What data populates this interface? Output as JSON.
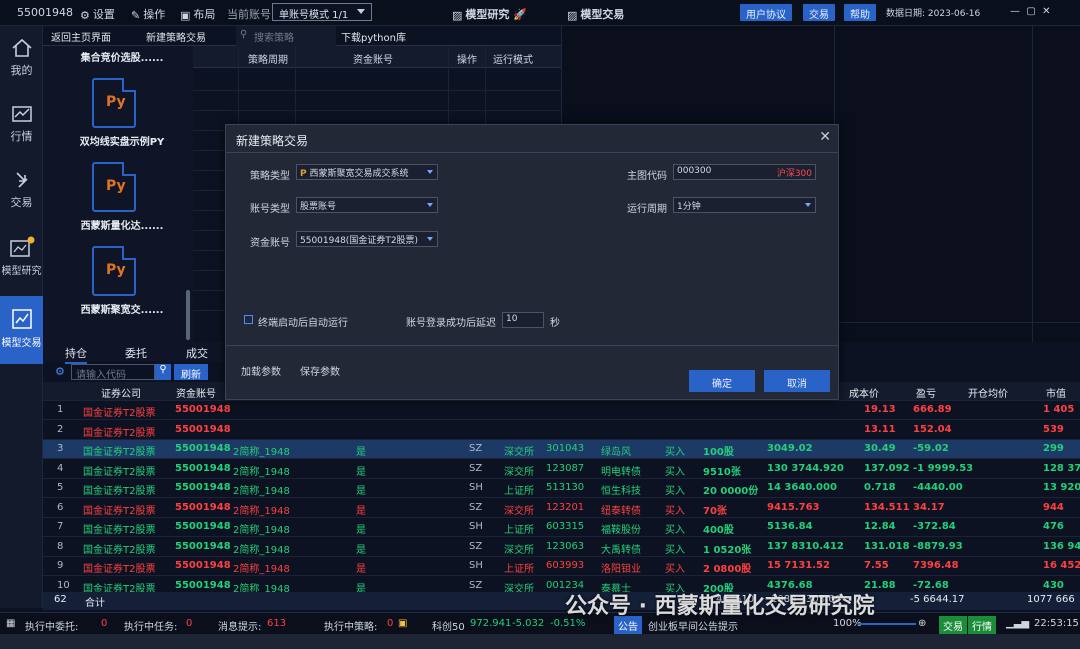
{
  "topbar": {
    "account_id": "55001948",
    "settings_label": "设置",
    "operate_label": "操作",
    "layout_label": "布局",
    "current_account_label": "当前账号",
    "account_mode": "单账号模式 1/1",
    "model_research_tab": "模型研究",
    "model_trade_tab": "模型交易",
    "user_agreement_btn": "用户协议",
    "trade_btn": "交易",
    "help_btn": "帮助",
    "data_date_label": "数据日期: 2023-06-16"
  },
  "sidebar": {
    "items": [
      {
        "label": "我的",
        "icon": "home-icon"
      },
      {
        "label": "行情",
        "icon": "chart-icon"
      },
      {
        "label": "交易",
        "icon": "arrows-icon"
      },
      {
        "label": "模型研究",
        "icon": "research-icon"
      },
      {
        "label": "模型交易",
        "icon": "model-trade-icon"
      }
    ]
  },
  "toptabs": {
    "back_home": "返回主页界面",
    "new_strategy": "新建策略交易",
    "search_placeholder": "搜索策略",
    "download_python": "下载python库"
  },
  "files": [
    {
      "label": "集合竞价选股......"
    },
    {
      "label": "双均线实盘示例PY",
      "icon_text": "Py"
    },
    {
      "label": "西蒙斯量化达......",
      "icon_text": "Py"
    },
    {
      "label": "西蒙斯聚宽交......",
      "icon_text": "Py"
    }
  ],
  "strategy_grid": {
    "headers": [
      "策略周期",
      "资金账号",
      "操作",
      "运行模式"
    ]
  },
  "dialog": {
    "title": "新建策略交易",
    "strategy_type_label": "策略类型",
    "strategy_type_value": "西蒙斯聚宽交易成交系统",
    "account_type_label": "账号类型",
    "account_type_value": "股票账号",
    "fund_account_label": "资金账号",
    "fund_account_value": "55001948(国金证券T2股票)",
    "main_code_label": "主图代码",
    "main_code_value": "000300",
    "main_code_name": "沪深300",
    "period_label": "运行周期",
    "period_value": "1分钟",
    "auto_run_label": "终端启动后自动运行",
    "delay_label": "账号登录成功后延迟",
    "delay_value": "10",
    "delay_unit": "秒",
    "load_params": "加载参数",
    "save_params": "保存参数",
    "confirm": "确定",
    "cancel": "取消"
  },
  "bottom": {
    "tabs": [
      "持仓",
      "委托",
      "成交"
    ],
    "search_placeholder": "请输入代码",
    "refresh": "刷新",
    "headers_left": [
      "证券公司",
      "资金账号"
    ],
    "headers_right": [
      "成本价",
      "盈亏",
      "开仓均价",
      "市值"
    ],
    "rows": [
      {
        "n": "1",
        "company": "国金证券T2股票",
        "acct": "55001948",
        "cost": "19.13",
        "pnl": "666.89",
        "mv": "1 405",
        "color": "red"
      },
      {
        "n": "2",
        "company": "国金证券T2股票",
        "acct": "55001948",
        "cost": "13.11",
        "pnl": "152.04",
        "mv": "539",
        "color": "red"
      },
      {
        "n": "3",
        "company": "国金证券T2股票",
        "acct": "55001948",
        "name2": "2简称_1948",
        "flag": "是",
        "mkt": "SZ",
        "ex": "深交所",
        "code": "301043",
        "sname": "绿岛风",
        "dir": "买入",
        "qty": "100股",
        "amt": "3049.02",
        "cost": "30.49",
        "pnl": "-59.02",
        "mv": "299",
        "color": "green"
      },
      {
        "n": "4",
        "company": "国金证券T2股票",
        "acct": "55001948",
        "name2": "2简称_1948",
        "flag": "是",
        "mkt": "SZ",
        "ex": "深交所",
        "code": "123087",
        "sname": "明电转债",
        "dir": "买入",
        "qty": "9510张",
        "amt": "130 3744.920",
        "cost": "137.092",
        "pnl": "-1 9999.53",
        "mv": "128 374",
        "color": "green"
      },
      {
        "n": "5",
        "company": "国金证券T2股票",
        "acct": "55001948",
        "name2": "2简称_1948",
        "flag": "是",
        "mkt": "SH",
        "ex": "上证所",
        "code": "513130",
        "sname": "恒生科技",
        "dir": "买入",
        "qty": "20 0000份",
        "amt": "14 3640.000",
        "cost": "0.718",
        "pnl": "-4440.00",
        "mv": "13 920",
        "color": "green"
      },
      {
        "n": "6",
        "company": "国金证券T2股票",
        "acct": "55001948",
        "name2": "2简称_1948",
        "flag": "是",
        "mkt": "SZ",
        "ex": "深交所",
        "code": "123201",
        "sname": "纽泰转债",
        "dir": "买入",
        "qty": "70张",
        "amt": "9415.763",
        "cost": "134.511",
        "pnl": "34.17",
        "mv": "944",
        "color": "red"
      },
      {
        "n": "7",
        "company": "国金证券T2股票",
        "acct": "55001948",
        "name2": "2简称_1948",
        "flag": "是",
        "mkt": "SH",
        "ex": "上证所",
        "code": "603315",
        "sname": "福鞍股份",
        "dir": "买入",
        "qty": "400股",
        "amt": "5136.84",
        "cost": "12.84",
        "pnl": "-372.84",
        "mv": "476",
        "color": "green"
      },
      {
        "n": "8",
        "company": "国金证券T2股票",
        "acct": "55001948",
        "name2": "2简称_1948",
        "flag": "是",
        "mkt": "SZ",
        "ex": "深交所",
        "code": "123063",
        "sname": "大禹转债",
        "dir": "买入",
        "qty": "1 0520张",
        "amt": "137 8310.412",
        "cost": "131.018",
        "pnl": "-8879.93",
        "mv": "136 943",
        "color": "green"
      },
      {
        "n": "9",
        "company": "国金证券T2股票",
        "acct": "55001948",
        "name2": "2简称_1948",
        "flag": "是",
        "mkt": "SH",
        "ex": "上证所",
        "code": "603993",
        "sname": "洛阳钼业",
        "dir": "买入",
        "qty": "2 0800股",
        "amt": "15 7131.52",
        "cost": "7.55",
        "pnl": "7396.48",
        "mv": "16 452",
        "color": "red"
      },
      {
        "n": "10",
        "company": "国金证券T2股票",
        "acct": "55001948",
        "name2": "2简称_1948",
        "flag": "是",
        "mkt": "SZ",
        "ex": "深交所",
        "code": "001234",
        "sname": "泰慕士",
        "dir": "买入",
        "qty": "200股",
        "amt": "4376.68",
        "cost": "21.88",
        "pnl": "-72.68",
        "mv": "430",
        "color": "green"
      }
    ],
    "sum": {
      "count": "62",
      "label": "合计",
      "amt": "464510",
      "amt2": "1083 3303.66",
      "pnl": "-5 6644.17",
      "mv": "1077 666"
    }
  },
  "statusbar": {
    "exec_orders_label": "执行中委托:",
    "exec_orders_value": "0",
    "exec_tasks_label": "执行中任务:",
    "exec_tasks_value": "0",
    "msg_label": "消息提示:",
    "msg_value": "613",
    "exec_strategy_label": "执行中策略:",
    "exec_strategy_value": "0",
    "index_name": "科创50",
    "index_value": "972.941",
    "index_change": "-5.032",
    "index_pct": "-0.51%",
    "notice_btn": "公告",
    "notice_text": "创业板早间公告提示",
    "zoom": "100%",
    "trade_btn": "交易",
    "market_btn": "行情",
    "time": "22:53:15"
  },
  "watermark": "公众号 · 西蒙斯量化交易研究院"
}
